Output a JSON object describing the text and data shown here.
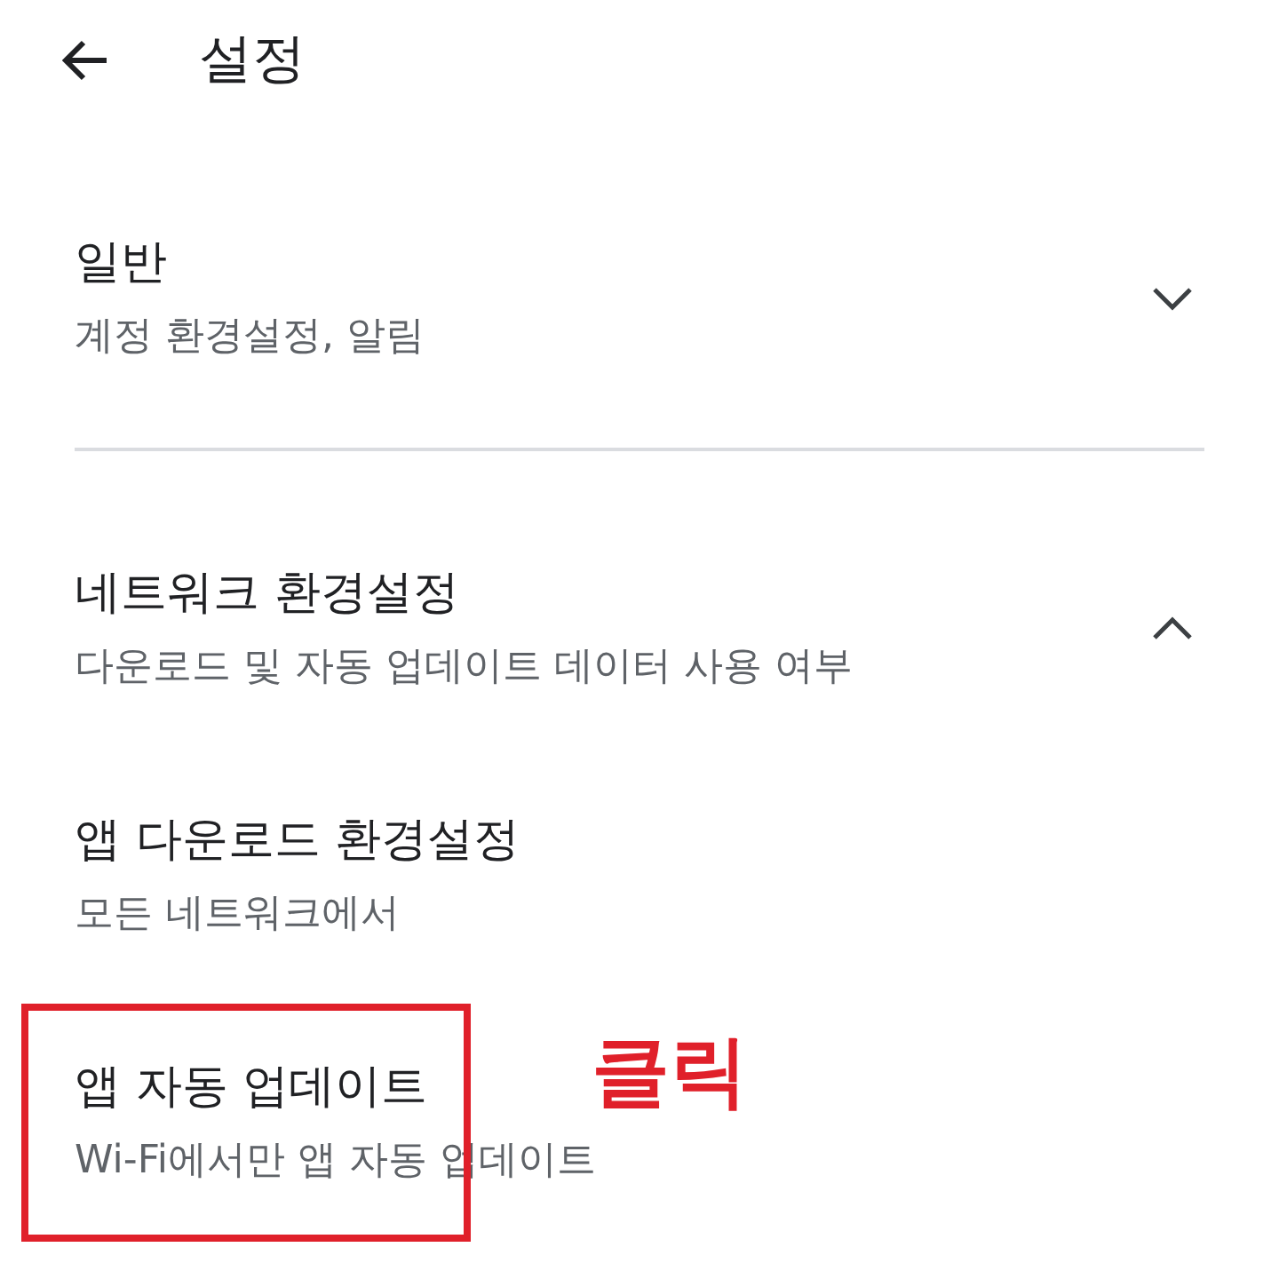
{
  "header": {
    "title": "설정"
  },
  "sections": [
    {
      "title": "일반",
      "subtitle": "계정 환경설정, 알림",
      "expanded": false
    },
    {
      "title": "네트워크 환경설정",
      "subtitle": "다운로드 및 자동 업데이트 데이터 사용 여부",
      "expanded": true,
      "items": [
        {
          "title": "앱 다운로드 환경설정",
          "subtitle": "모든 네트워크에서",
          "highlighted": false
        },
        {
          "title": "앱 자동 업데이트",
          "subtitle": "Wi-Fi에서만 앱 자동 업데이트",
          "highlighted": true
        }
      ]
    }
  ],
  "annotation": {
    "label": "클릭"
  }
}
